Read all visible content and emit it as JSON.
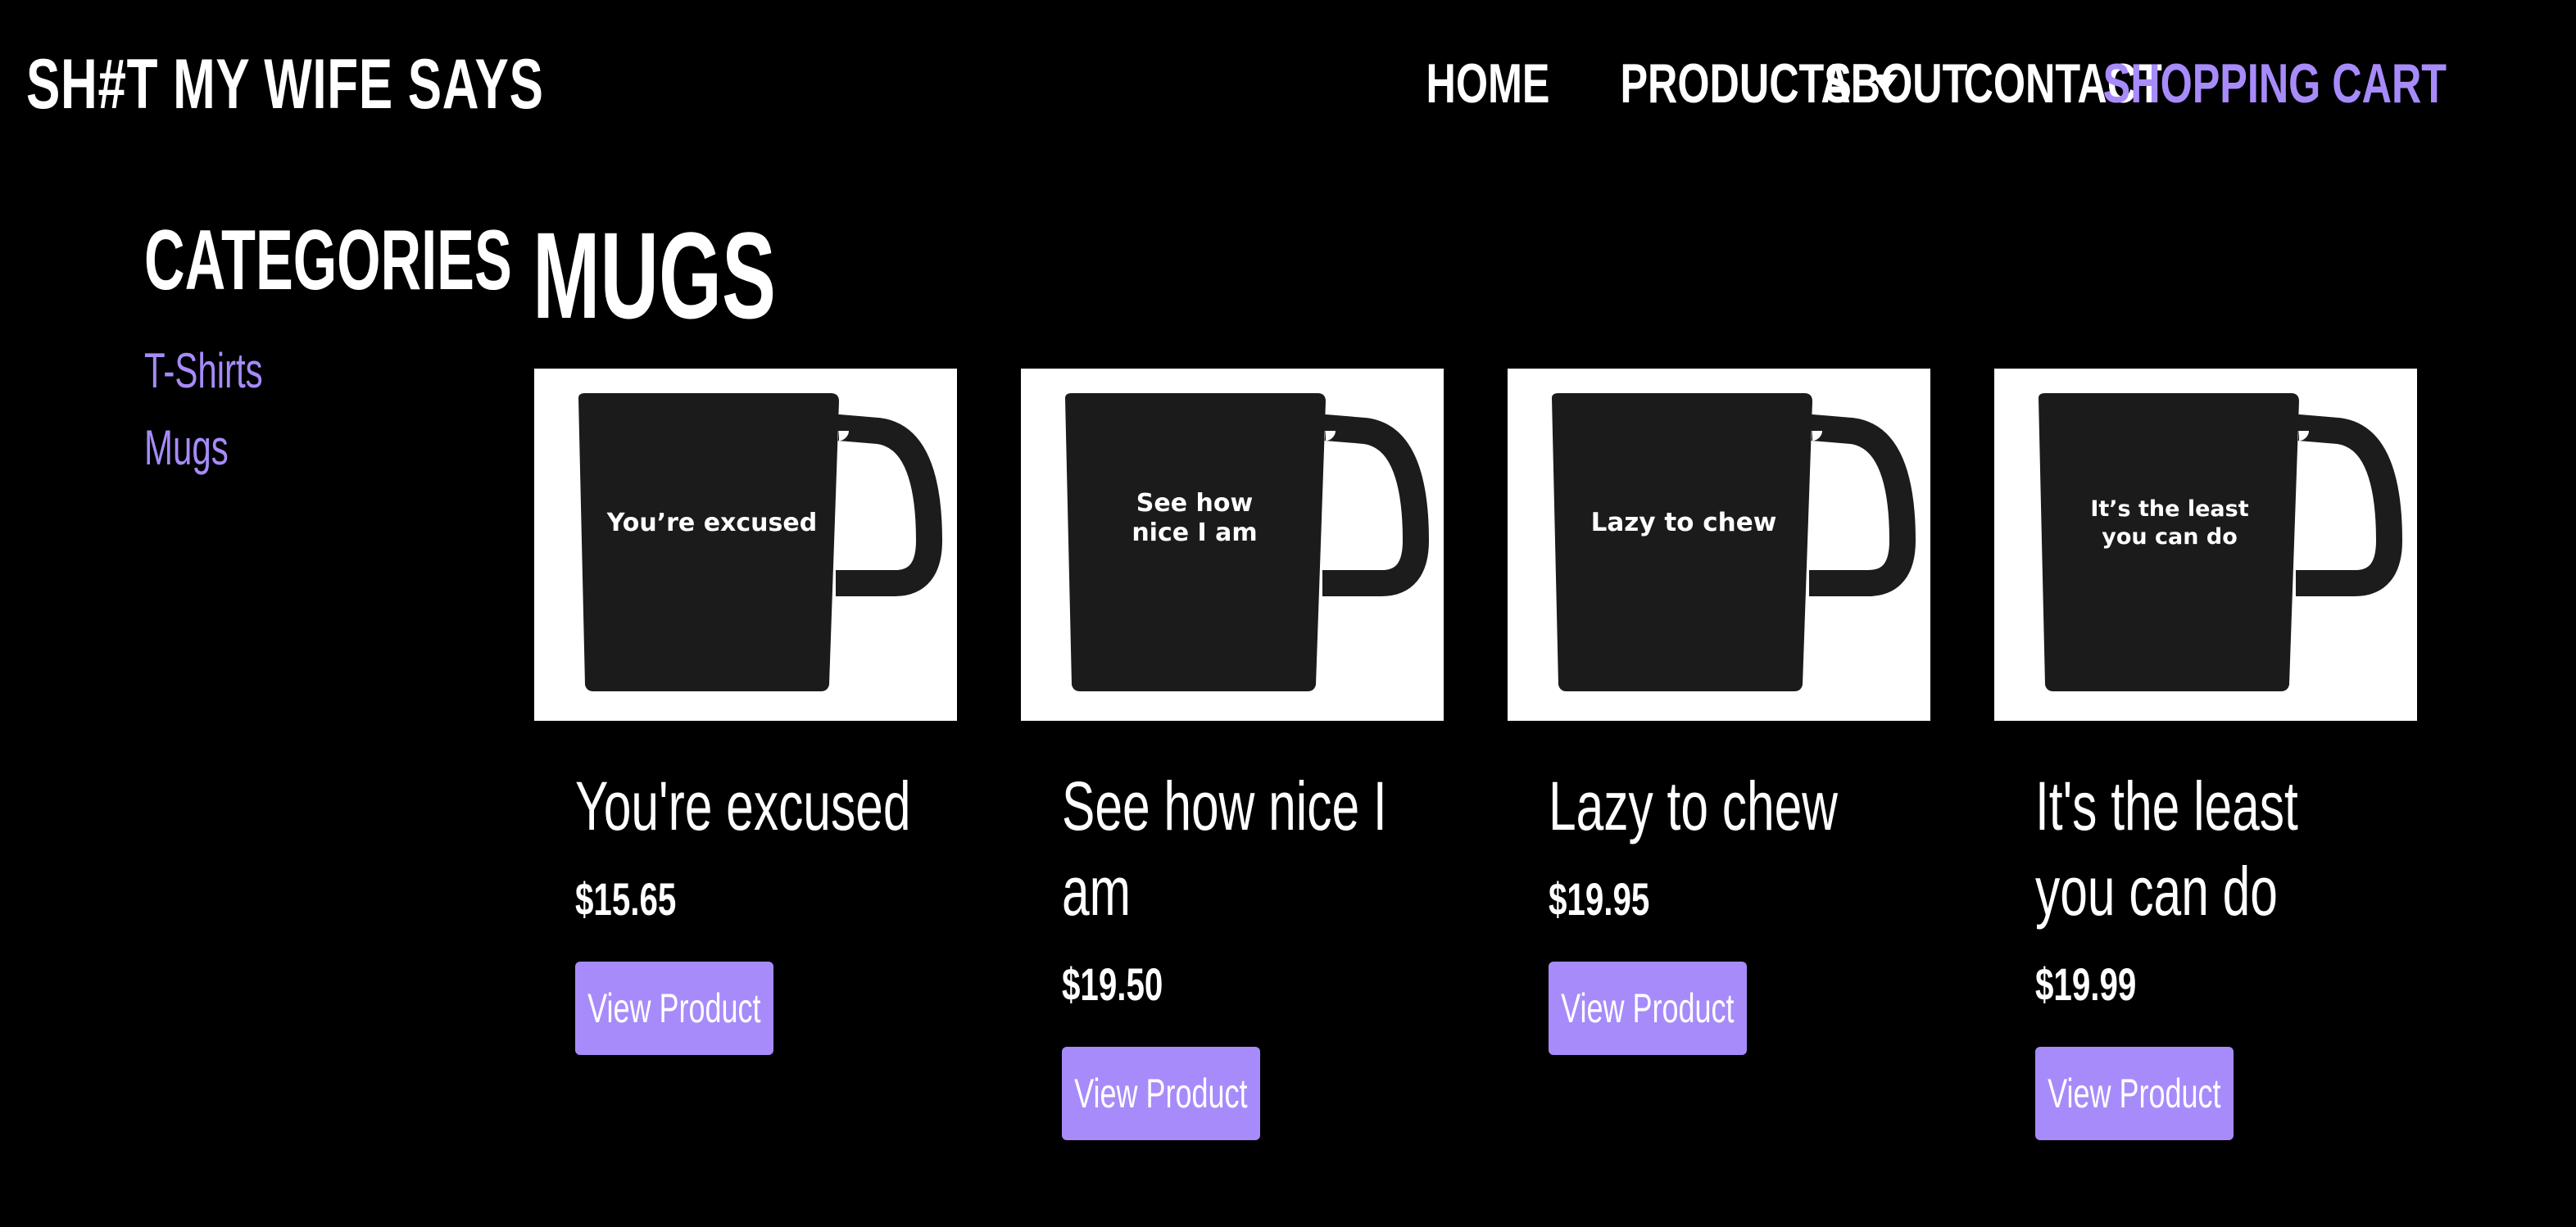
{
  "header": {
    "brand": "SH#T MY WIFE SAYS",
    "nav": {
      "home": "HOME",
      "products": "PRODUCTS",
      "about": "ABOUT",
      "contact": "CONTACT",
      "cart": "SHOPPING CART"
    }
  },
  "sidebar": {
    "title": "CATEGORIES",
    "links": [
      "T-Shirts",
      "Mugs"
    ]
  },
  "main": {
    "title": "MUGS",
    "products": [
      {
        "name": "You're excused",
        "price": "$15.65",
        "button": "View Product",
        "mug_text_lines": [
          "You’re excused"
        ]
      },
      {
        "name": "See how nice I am",
        "price": "$19.50",
        "button": "View Product",
        "mug_text_lines": [
          "See how",
          "nice I am"
        ]
      },
      {
        "name": "Lazy to chew",
        "price": "$19.95",
        "button": "View Product",
        "mug_text_lines": [
          "Lazy to chew"
        ]
      },
      {
        "name": "It's the least you can do",
        "price": "$19.99",
        "button": "View Product",
        "mug_text_lines": [
          "It’s the least",
          "you can do"
        ]
      }
    ]
  },
  "colors": {
    "background": "#000000",
    "accent": "#a78bfa",
    "text": "#ffffff"
  },
  "icons": {
    "cart": "shopping-cart-icon",
    "dropdown": "chevron-down-icon"
  }
}
